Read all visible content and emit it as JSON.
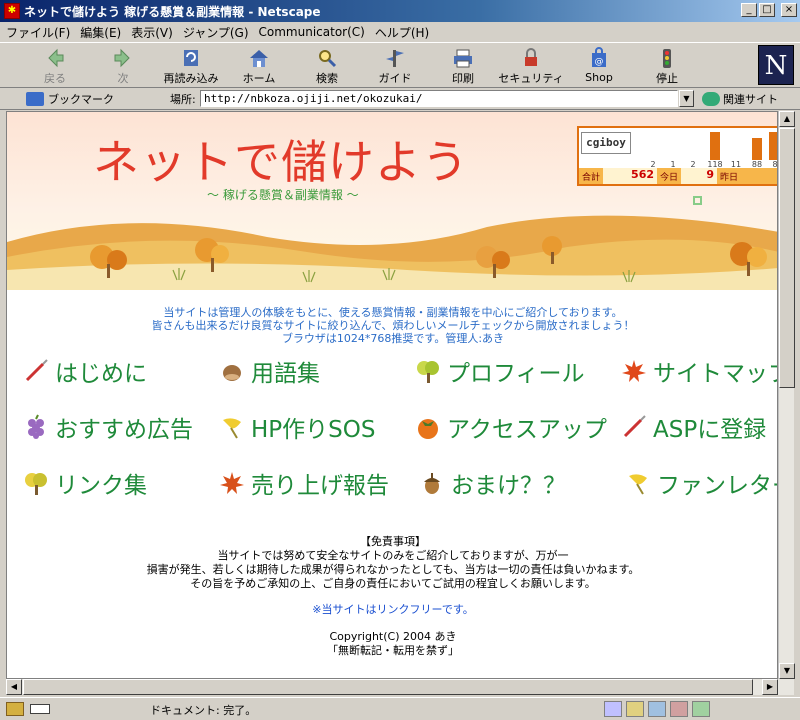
{
  "window": {
    "title": "ネットで儲けよう  稼げる懸賞＆副業情報 - Netscape",
    "icon": "netscape-window-icon",
    "buttons": {
      "minimize": "_",
      "maximize": "□",
      "close": "×"
    }
  },
  "menu": [
    "ファイル(F)",
    "編集(E)",
    "表示(V)",
    "ジャンプ(G)",
    "Communicator(C)",
    "ヘルプ(H)"
  ],
  "toolbar": [
    {
      "id": "back",
      "label": "戻る",
      "icon": "back-arrow-icon",
      "disabled": true
    },
    {
      "id": "forward",
      "label": "次",
      "icon": "forward-arrow-icon",
      "disabled": true
    },
    {
      "id": "reload",
      "label": "再読み込み",
      "icon": "reload-icon",
      "disabled": false
    },
    {
      "id": "home",
      "label": "ホーム",
      "icon": "home-icon",
      "disabled": false
    },
    {
      "id": "search",
      "label": "検索",
      "icon": "search-icon",
      "disabled": false
    },
    {
      "id": "guide",
      "label": "ガイド",
      "icon": "guide-icon",
      "disabled": false
    },
    {
      "id": "print",
      "label": "印刷",
      "icon": "print-icon",
      "disabled": false
    },
    {
      "id": "security",
      "label": "セキュリティ",
      "icon": "lock-icon",
      "disabled": false
    },
    {
      "id": "shop",
      "label": "Shop",
      "icon": "shop-icon",
      "disabled": false
    },
    {
      "id": "stop",
      "label": "停止",
      "icon": "stop-icon",
      "disabled": false
    }
  ],
  "netscape_logo": "N",
  "location": {
    "bookmarks_label": "ブックマーク",
    "location_label": "場所:",
    "url": "http://nbkoza.ojiji.net/okozukai/",
    "related_label": "関連サイト"
  },
  "banner": {
    "title": "ネットで儲けよう",
    "subtitle": "～ 稼げる懸賞＆副業情報 ～"
  },
  "counter": {
    "logo": "cgiboy",
    "bar_labels": [
      "2",
      "1",
      "2",
      "118",
      "11",
      "88",
      "8"
    ],
    "total_label": "合計",
    "total": "562",
    "today_label": "今日",
    "today": "9",
    "yesterday_label": "昨日"
  },
  "intro": [
    "当サイトは管理人の体験をもとに、使える懸賞情報・副業情報を中心にご紹介しております。",
    "皆さんも出来るだけ良質なサイトに絞り込んで、煩わしいメールチェックから開放されましょう！",
    "ブラウザは1024*768推奨です。管理人:あき"
  ],
  "nav": [
    {
      "label": "はじめに",
      "icon": "pen-icon"
    },
    {
      "label": "用語集",
      "icon": "chestnut-icon"
    },
    {
      "label": "プロフィール",
      "icon": "tree-icon"
    },
    {
      "label": "サイトマップ",
      "icon": "maple-leaf-icon"
    },
    {
      "label": "おすすめ広告",
      "icon": "grapes-icon"
    },
    {
      "label": "HP作りSOS",
      "icon": "ginkgo-icon"
    },
    {
      "label": "アクセスアップ",
      "icon": "persimmon-icon"
    },
    {
      "label": "ASPに登録",
      "icon": "pen-icon"
    },
    {
      "label": "リンク集",
      "icon": "tree-icon"
    },
    {
      "label": "売り上げ報告",
      "icon": "maple-leaf-icon"
    },
    {
      "label": "おまけ？？",
      "icon": "acorn-icon"
    },
    {
      "label": "ファンレター",
      "icon": "ginkgo-icon"
    }
  ],
  "disclaimer": {
    "heading": "【免責事項】",
    "lines": [
      "当サイトでは努めて安全なサイトのみをご紹介しておりますが、万が一",
      "損害が発生、若しくは期待した成果が得られなかったとしても、当方は一切の責任は負いかねます。",
      "その旨を予めご承知の上、ご自身の責任においてご試用の程宜しくお願いします。"
    ]
  },
  "link_free": "※当サイトはリンクフリーです。",
  "copyright": "Copyright(C) 2004 あき",
  "no_reprint": "「無断転記・転用を禁ず」",
  "status": {
    "text": "ドキュメント: 完了。"
  },
  "colors": {
    "title_red": "#e23a2a",
    "nav_green": "#1f8a3a",
    "intro_blue": "#2b6cc7",
    "link_blue": "#1a4fd0",
    "counter_orange": "#e07010"
  }
}
